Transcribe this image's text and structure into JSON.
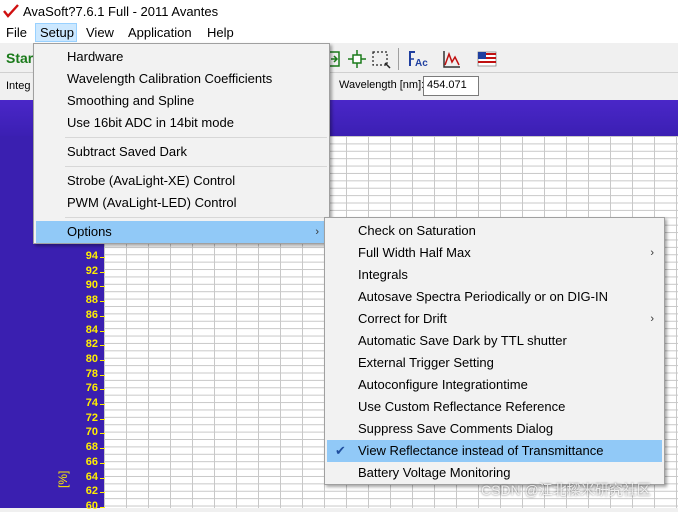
{
  "window": {
    "title": "AvaSoft?7.6.1 Full - 2011 Avantes"
  },
  "menubar": {
    "file": "File",
    "setup": "Setup",
    "view": "View",
    "application": "Application",
    "help": "Help"
  },
  "toolbar": {
    "start_label": "Star"
  },
  "row2": {
    "integration_label": "Integ",
    "wavelength_label": "Wavelength [nm]:",
    "wavelength_value": "454.071"
  },
  "graph": {
    "y_ticks": [
      "94",
      "92",
      "90",
      "88",
      "86",
      "84",
      "82",
      "80",
      "78",
      "76",
      "74",
      "72",
      "70",
      "68",
      "66",
      "64",
      "62",
      "60"
    ],
    "y_unit": "[%]"
  },
  "setup_menu": {
    "items": [
      "Hardware",
      "Wavelength Calibration Coefficients",
      "Smoothing and Spline",
      "Use 16bit ADC in 14bit mode",
      "Subtract Saved Dark",
      "Strobe (AvaLight-XE) Control",
      "PWM (AvaLight-LED) Control",
      "Options"
    ]
  },
  "options_menu": {
    "items": [
      "Check on Saturation",
      "Full Width Half Max",
      "Integrals",
      "Autosave Spectra Periodically or on DIG-IN",
      "Correct for Drift",
      "Automatic Save Dark by TTL shutter",
      "External Trigger Setting",
      "Autoconfigure Integrationtime",
      "Use Custom Reflectance Reference",
      "Suppress Save Comments Dialog",
      "View Reflectance instead of Transmittance",
      "Battery Voltage Monitoring"
    ]
  },
  "watermark": "CSDN @江北樑米研究社区",
  "colors": {
    "highlight": "#91c9f7",
    "graph_bg": "#3a1fb0",
    "axis_text": "#ffee00"
  }
}
